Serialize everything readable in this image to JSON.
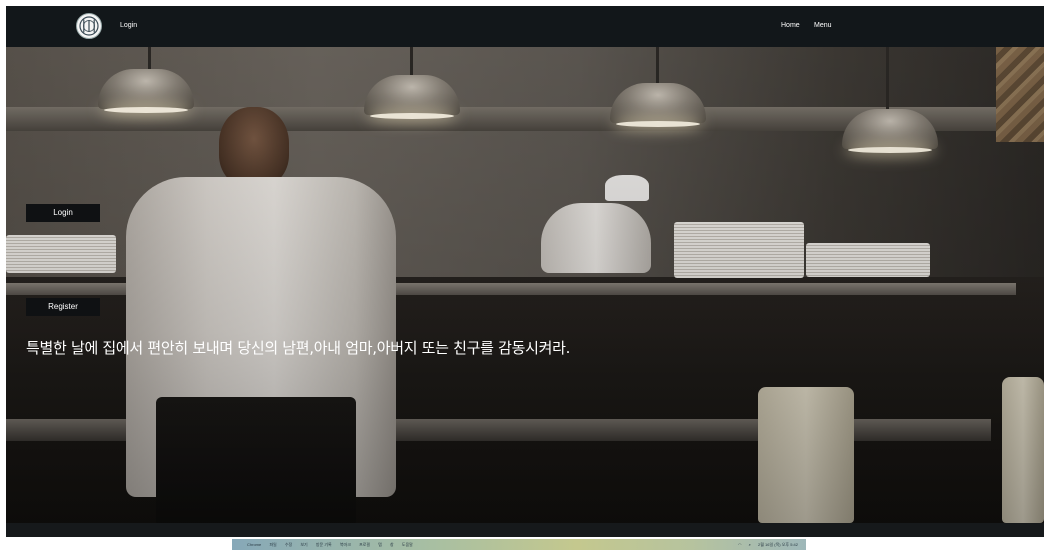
{
  "navbar": {
    "logo_icon": "cutlery-plate-icon",
    "login_label": "Login",
    "home_label": "Home",
    "menu_label": "Menu"
  },
  "hero": {
    "login_button": "Login",
    "register_button": "Register",
    "tagline": "특별한 날에 집에서 편안히 보내며 당신의 남편,아내 엄마,아버지 또는 친구를 감동시켜라."
  },
  "taskbar": {
    "apple_icon": "apple-icon",
    "app_name": "Chrome",
    "menus": [
      "파일",
      "수정",
      "보기",
      "방문 기록",
      "북마크",
      "프로필",
      "탭",
      "창",
      "도움말"
    ],
    "status": "2월 16일 (목) 오후 5:42"
  },
  "colors": {
    "navbar": "#12171a",
    "button": "#0f1113",
    "text": "#ffffff"
  }
}
